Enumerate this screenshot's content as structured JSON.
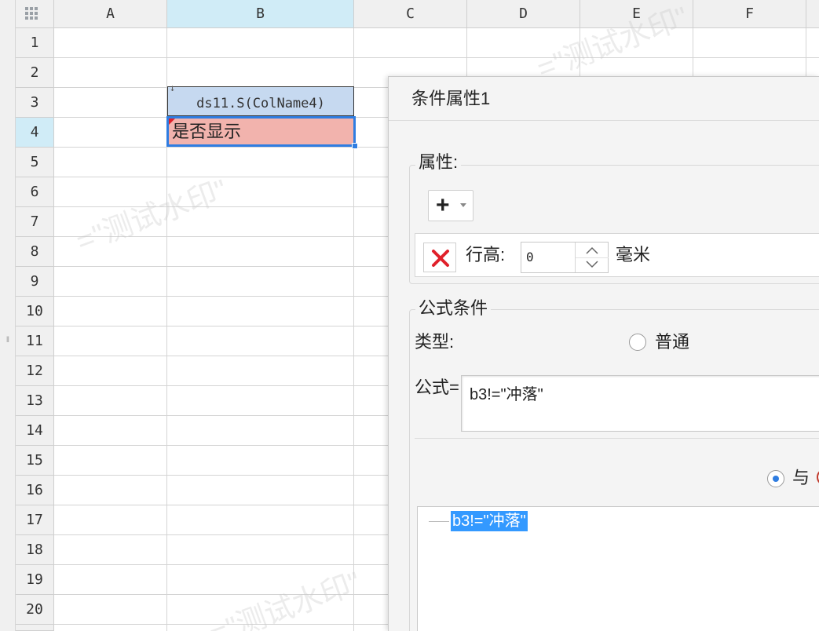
{
  "spreadsheet": {
    "columns": [
      "A",
      "B",
      "C",
      "D",
      "E",
      "F"
    ],
    "selected_column": "B",
    "rows": [
      "1",
      "2",
      "3",
      "4",
      "5",
      "6",
      "7",
      "8",
      "9",
      "10",
      "11",
      "12",
      "13",
      "14",
      "15",
      "16",
      "17",
      "18",
      "19",
      "20"
    ],
    "selected_row": "4",
    "cell_b3": "ds11.S(ColName4)",
    "cell_b4": "是否显示",
    "watermark": "=\"测试水印\""
  },
  "dialog": {
    "title": "条件属性1",
    "attributes_group": {
      "legend": "属性:",
      "add_button_icon": "plus-icon",
      "row": {
        "delete_icon": "red-x-icon",
        "label": "行高:",
        "value": "0",
        "unit": "毫米"
      }
    },
    "formula_group": {
      "legend": "公式条件",
      "type_label": "类型:",
      "type_option_normal": "普通",
      "formula_label": "公式=",
      "formula_value": "b3!=\"冲落\"",
      "and_label": "与",
      "tree_node": "b3!=\"冲落\""
    }
  },
  "colors": {
    "selected_header": "#d0ecf7",
    "b3_fill": "#c6d9f0",
    "b4_fill": "#f2b3ad",
    "selection_border": "#2f7de1",
    "tree_highlight": "#3399ff",
    "delete_red": "#e0202a"
  }
}
